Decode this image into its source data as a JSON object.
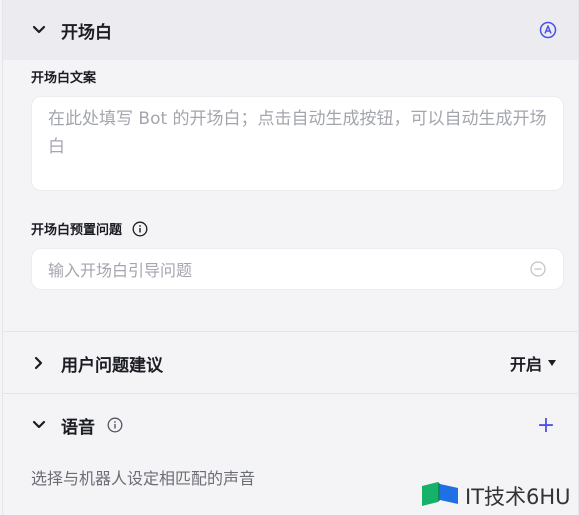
{
  "opening": {
    "title": "开场白",
    "auto_icon": "auto-generate-icon",
    "text_label": "开场白文案",
    "text_placeholder": "在此处填写 Bot 的开场白；点击自动生成按钮，可以自动生成开场白",
    "preset_label": "开场白预置问题",
    "preset_placeholder": "输入开场白引导问题"
  },
  "suggestions": {
    "title": "用户问题建议",
    "value": "开启"
  },
  "voice": {
    "title": "语音",
    "add": "+",
    "hint": "选择与机器人设定相匹配的声音"
  },
  "watermark": {
    "text": "IT技术6HU"
  },
  "colors": {
    "accent": "#4d53e8",
    "brand_green": "#17b26a",
    "brand_blue": "#1f6fe5"
  }
}
